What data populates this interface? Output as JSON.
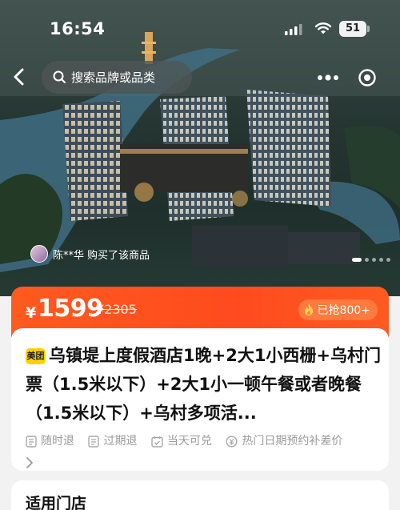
{
  "status_bar": {
    "time": "16:54",
    "battery": "51"
  },
  "search": {
    "placeholder": "搜索品牌或品类",
    "icon": "search-icon"
  },
  "nav": {
    "back_icon": "chevron-left-icon",
    "more_icon": "more-dots-icon",
    "target_icon": "target-icon"
  },
  "buyer_notice": {
    "name": "陈**华",
    "action": "购买了该商品"
  },
  "gallery": {
    "dots_total": 5,
    "active_index": 0
  },
  "price": {
    "currency": "¥",
    "current": "1599",
    "original": "¥2305",
    "sold_label": "已抢800+"
  },
  "product": {
    "brand_badge": "美团",
    "title": "乌镇堤上度假酒店1晚+2大1小西栅+乌村门票（1.5米以下）+2大1小一顿午餐或者晚餐（1.5米以下）+乌村多项活..."
  },
  "tags": [
    {
      "label": "随时退",
      "icon": "document-icon"
    },
    {
      "label": "过期退",
      "icon": "document-icon"
    },
    {
      "label": "当天可兑",
      "icon": "calendar-check-icon"
    },
    {
      "label": "热门日期预约补差价",
      "icon": "yuan-circle-icon"
    }
  ],
  "store_section": {
    "title": "适用门店"
  },
  "colors": {
    "accent": "#ff4b1e",
    "brand_yellow": "#ffd000",
    "muted_text": "#9a9a9a"
  }
}
